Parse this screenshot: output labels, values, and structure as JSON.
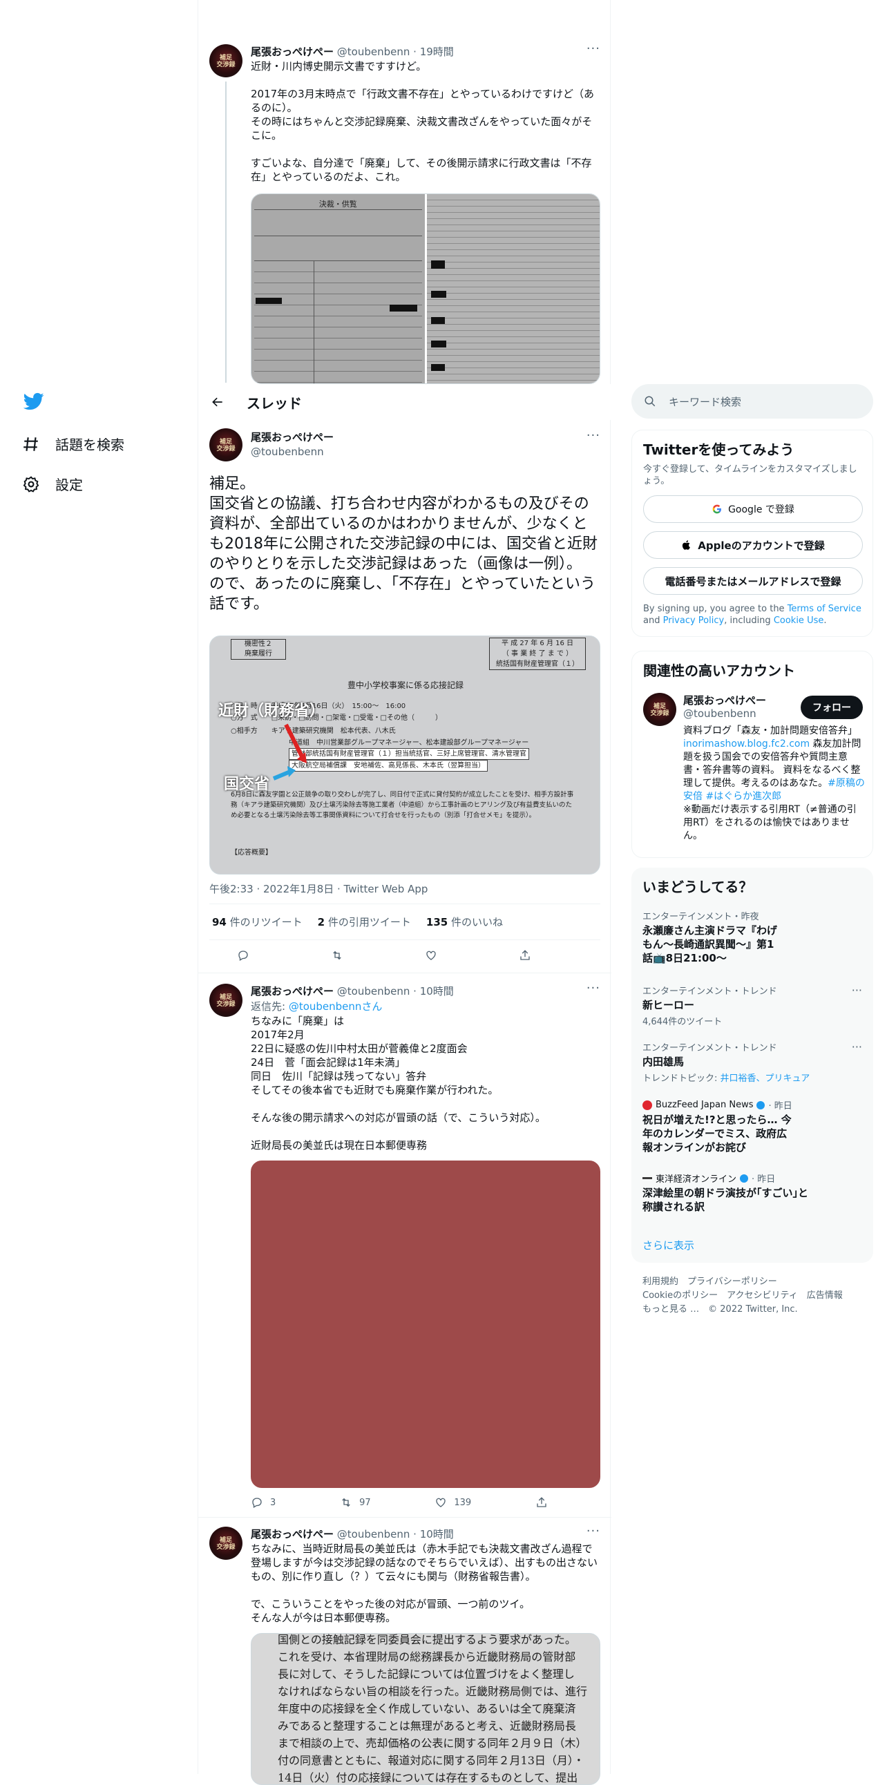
{
  "colors": {
    "accent": "#1d9bf0",
    "text": "#0f1419",
    "muted": "#536471"
  },
  "nav": {
    "explore": "話題を検索",
    "settings": "設定"
  },
  "header": {
    "title": "スレッド"
  },
  "search": {
    "placeholder": "キーワード検索"
  },
  "tweet1": {
    "name": "尾張おっぺけぺー",
    "handle": "@toubenbenn",
    "time": "· 19時間",
    "text": "近財・川内博史開示文書ですすけど。\n\n2017年の3月末時点で「行政文書不存在」とやっているわけですけど（あるのに）。\nその時にはちゃんと交渉記録廃棄、決裁文書改ざんをやっていた面々がそこに。\n\nすごいよな、自分達で「廃棄」して、その後開示請求に行政文書は「不存在」とやっているのだよ、これ。",
    "doc_title": "決裁・供覧"
  },
  "main_tweet": {
    "name": "尾張おっぺけぺー",
    "handle": "@toubenbenn",
    "text": "補足。\n国交省との協議、打ち合わせ内容がわかるもの及びその資料が、全部出ているのかはわかりませんが、少なくとも2018年に公開された交渉記録の中には、国交省と近財のやりとりを示した交渉記録はあった（画像は一例）。\nので、あったのに廃棄し、「不存在」とやっていたという話です。",
    "image": {
      "stamp1": "機密性２",
      "stamp2": "廃棄履行",
      "box1": "平 成 27 年 6 月 16 日",
      "box2": "（ 事 業 終 了 ま で ）",
      "box3": "統括国有財産管理官（１）",
      "heading": "豊中小学校事案に係る応接記録",
      "label1": "近財（財務省）",
      "label2": "国交省",
      "line1": "○日　時　　平成27年6月16日（火）　15:00～　16:00",
      "line2": "○方　式　　□来訪・□訪問・□架電・□受電・□その他（　　　）",
      "line3": "○相手方　　キアラ建築研究機関　松本代表、八木氏",
      "line4": "中道組　中川営業部グループマネージャー、松本建設部グループマネージャー",
      "line5": "管財部統括国有財産管理官（１）担当統括官、三好上席管理官、清水管理官",
      "line6": "大阪航空局補償課　安地補佐、高見係長、木本氏（翌算担当）",
      "para": "6月8日に森友学園と公正競争の取り交わしが完了し、同日付で正式に貸付契約が成立したことを受け、相手方設計事務（キアラ建築研究機関）及び土壌汚染除去等施工業者（中道組）から工事計画のヒアリング及び有益費支払いのため必要となる土壌汚染除去等工事関係資料について打合せを行ったもの（別添「打合せメモ」を提示）。",
      "foot": "【応答概要】"
    },
    "meta": "午後2:33 · 2022年1月8日 · Twitter Web App",
    "stats": [
      {
        "num": "94",
        "label": "件のリツイート"
      },
      {
        "num": "2",
        "label": "件の引用ツイート"
      },
      {
        "num": "135",
        "label": "件のいいね"
      }
    ]
  },
  "reply1": {
    "name": "尾張おっぺけぺー",
    "handle": "@toubenbenn",
    "time": "· 10時間",
    "reply_prefix": "返信先: ",
    "reply_to": "@toubenbennさん",
    "text": "ちなみに「廃棄」は\n2017年2月\n22日に疑惑の佐川中村太田が菅義偉と2度面会\n24日　菅「面会記録は1年未満」\n同日　佐川「記録は残ってない」答弁\nそしてその後本省でも近財でも廃棄作業が行われた。\n\nそんな後の開示請求への対応が冒頭の話（で、こういう対応）。\n\n近財局長の美並氏は現在日本郵便専務",
    "replies": "3",
    "retweets": "97",
    "likes": "139"
  },
  "reply2": {
    "name": "尾張おっぺけぺー",
    "handle": "@toubenbenn",
    "time": "· 10時間",
    "text": "ちなみに、当時近財局長の美並氏は（赤木手記でも決裁文書改ざん過程で登場しますが今は交渉記録の話なのでそちらでいえば）、出すもの出さないもの、別に作り直し（？）て云々にも関与（財務省報告書）。\n\nで、こういうことをやった後の対応が冒頭、一つ前のツイ。\nそんな人が今は日本郵便専務。",
    "doc_lines": [
      "国側との接触記録を同委員会に提出するよう要求があった。",
      "これを受け、本省理財局の総務課長から近畿財務局の管財部",
      "長に対して、そうした記録については位置づけをよく整理し",
      "なければならない旨の相談を行った。近畿財務局側では、進行",
      "年度中の応接録を全く作成していない、あるいは全て廃棄済",
      "みであると整理することは無理があると考え、近畿財務局長",
      "まで相談の上で、売却価格の公表に関する同年２月９日（木）",
      "付の同意書とともに、報道対応に関する同年２月13日（月）・",
      "14日（火）付の応接録については存在するものとして、提出"
    ]
  },
  "signup": {
    "title": "Twitterを使ってみよう",
    "desc": "今すぐ登録して、タイムラインをカスタマイズしましょう。",
    "google": "Google で登録",
    "apple": "Appleのアカウントで登録",
    "phone": "電話番号またはメールアドレスで登録",
    "terms_1": "By signing up, you agree to the ",
    "terms_link1": "Terms of Service",
    "terms_2": " and ",
    "terms_link2": "Privacy Policy",
    "terms_3": ", including ",
    "terms_link3": "Cookie Use",
    "terms_4": "."
  },
  "related": {
    "title": "関連性の高いアカウント",
    "name": "尾張おっぺけぺー",
    "handle": "@toubenbenn",
    "follow": "フォロー",
    "bio_1": "資料ブログ「森友・加計問題安倍答弁」",
    "bio_link": "inorimashow.blog.fc2.com",
    "bio_2": " 森友加計問題を扱う国会での安倍答弁や質問主意書・答弁書等の資料。 資料をなるべく整理して提供。考えるのはあなた。",
    "bio_tags": "#原稿の安倍 #はぐらか進次郎",
    "bio_3": "\n※動画だけ表示する引用RT（≠普通の引用RT）をされるのは愉快ではありません。"
  },
  "trends": {
    "title": "いまどうしてる？",
    "items": [
      {
        "cat": "エンターテインメント・昨夜",
        "title": "永瀬廉さん主演ドラマ『わげもん～長崎通訳異聞～』第1話📺8日21:00～"
      },
      {
        "cat": "エンターテインメント・トレンド",
        "title": "新ヒーロー",
        "sub": "4,644件のツイート"
      },
      {
        "cat": "エンターテインメント・トレンド",
        "title": "内田雄馬",
        "sub_prefix": "トレンドトピック: ",
        "sub_link": "井口裕香、プリキュア"
      },
      {
        "cat": "BuzzFeed Japan News",
        "cat_time": "· 昨日",
        "title": "祝日が増えた!?と思ったら… 今年のカレンダーでミス、政府広報オンラインがお詫び"
      },
      {
        "cat": "東洋経済オンライン",
        "cat_time": "· 昨日",
        "title": "深津絵里の朝ドラ演技が｢すごい｣と称讃される訳"
      }
    ],
    "more": "さらに表示"
  },
  "footer": {
    "l1a": "利用規約",
    "l1b": "プライバシーポリシー",
    "l2a": "Cookieのポリシー",
    "l2b": "アクセシビリティ",
    "l2c": "広告情報",
    "l3a": "もっと見る …",
    "l3b": "© 2022 Twitter, Inc."
  }
}
